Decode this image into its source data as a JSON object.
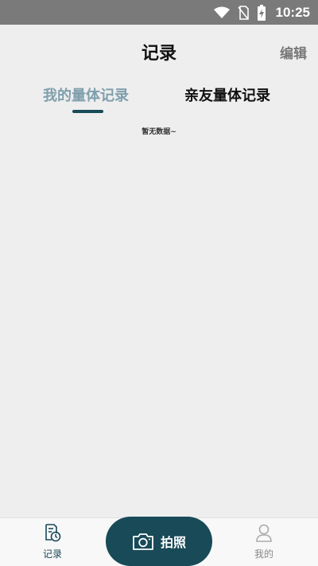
{
  "status_bar": {
    "time": "10:25",
    "icons": [
      "wifi-icon",
      "no-sim-icon",
      "battery-charging-icon"
    ]
  },
  "nav": {
    "title": "记录",
    "edit_label": "编辑"
  },
  "tabs": [
    {
      "label": "我的量体记录",
      "active": true
    },
    {
      "label": "亲友量体记录",
      "active": false
    }
  ],
  "empty_state": {
    "text": "暂无数据~"
  },
  "bottom_nav": {
    "records_label": "记录",
    "camera_label": "拍照",
    "mine_label": "我的"
  },
  "colors": {
    "accent": "#184a58",
    "active_tab": "#7f9fad",
    "status_bar": "#7a7a7a",
    "background": "#eeeeee"
  }
}
